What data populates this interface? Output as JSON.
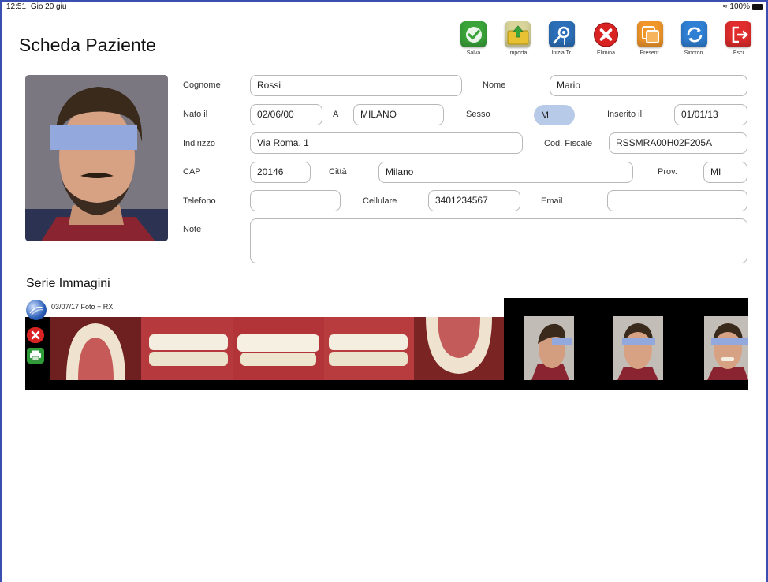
{
  "status": {
    "time": "12:51",
    "date": "Gio 20 giu",
    "battery": "100%"
  },
  "page": {
    "title": "Scheda Paziente"
  },
  "toolbar": [
    {
      "id": "salva",
      "label": "Salva",
      "icon": "check-icon",
      "color": "#3aa43a"
    },
    {
      "id": "importa",
      "label": "Importa",
      "icon": "folder-import-icon",
      "color": "#c9c58a"
    },
    {
      "id": "inizia",
      "label": "Inizia Tr.",
      "icon": "treatment-start-icon",
      "color": "#2c6fb8"
    },
    {
      "id": "elimina",
      "label": "Elimina",
      "icon": "delete-icon",
      "color": "#d92323"
    },
    {
      "id": "present",
      "label": "Present.",
      "icon": "presentation-icon",
      "color": "#f0962a"
    },
    {
      "id": "sincron",
      "label": "Sincron.",
      "icon": "sync-icon",
      "color": "#2f7fd4"
    },
    {
      "id": "esci",
      "label": "Esci",
      "icon": "exit-icon",
      "color": "#e02c2c"
    }
  ],
  "form": {
    "cognome_label": "Cognome",
    "cognome": "Rossi",
    "nome_label": "Nome",
    "nome": "Mario",
    "nato_label": "Nato il",
    "nato": "02/06/00",
    "a_label": "A",
    "luogo": "MILANO",
    "sesso_label": "Sesso",
    "sesso": "M",
    "inserito_label": "Inserito il",
    "inserito": "01/01/13",
    "indirizzo_label": "Indirizzo",
    "indirizzo": "Via Roma, 1",
    "cf_label": "Cod. Fiscale",
    "cf": "RSSMRA00H02F205A",
    "cap_label": "CAP",
    "cap": "20146",
    "citta_label": "Città",
    "citta": "Milano",
    "prov_label": "Prov.",
    "prov": "MI",
    "telefono_label": "Telefono",
    "telefono": "",
    "cellulare_label": "Cellulare",
    "cellulare": "3401234567",
    "email_label": "Email",
    "email": "",
    "note_label": "Note",
    "note": ""
  },
  "serie": {
    "title": "Serie Immagini",
    "items": [
      {
        "date_label": "03/07/17 Foto + RX"
      }
    ]
  }
}
